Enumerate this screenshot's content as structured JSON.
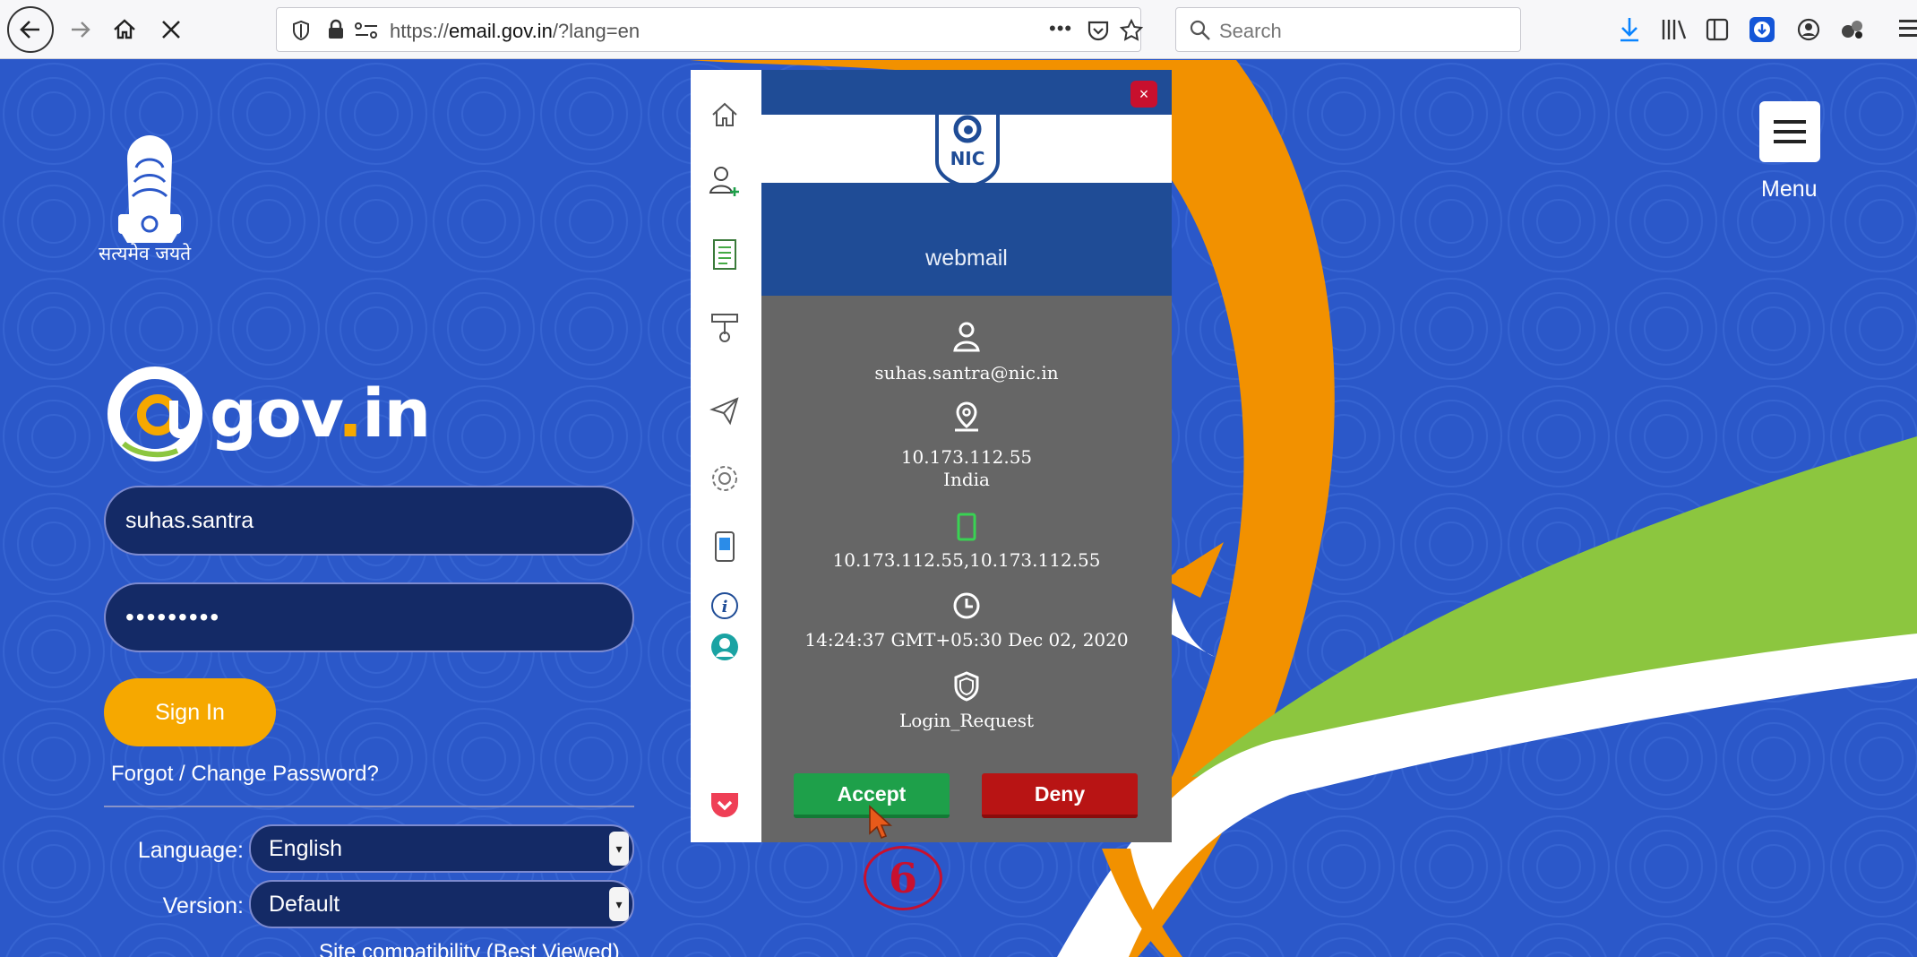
{
  "browser": {
    "url_prefix": "https://",
    "url_domain": "email.gov.in",
    "url_path": "/?lang=en",
    "search_placeholder": "Search"
  },
  "page": {
    "motto": "सत्यमेव जयते",
    "brand_name": "gov",
    "brand_dot": ".",
    "brand_tld": "in",
    "username": "suhas.santra",
    "password_mask": "•••••••••",
    "signin_label": "Sign In",
    "forgot_label": "Forgot / Change Password?",
    "language_label": "Language:",
    "language_value": "English",
    "version_label": "Version:",
    "version_value": "Default",
    "compat_label": "Site compatibility (Best Viewed)",
    "menu_label": "Menu"
  },
  "popup": {
    "logo_text": "NIC",
    "title": "webmail",
    "email": "suhas.santra@nic.in",
    "ip": "10.173.112.55",
    "country": "India",
    "device_ips": "10.173.112.55,10.173.112.55",
    "timestamp": "14:24:37 GMT+05:30 Dec 02, 2020",
    "request_type": "Login_Request",
    "accept_label": "Accept",
    "deny_label": "Deny",
    "close_symbol": "×"
  },
  "annotation": {
    "step_number": "6"
  },
  "colors": {
    "page_blue": "#2b58c9",
    "accent_orange": "#f6a800",
    "ribbon_green": "#8cc63f",
    "popup_navy": "#1f4c96",
    "popup_grey": "#666666",
    "accept_green": "#1ea04a",
    "deny_red": "#b81414",
    "pocket_red": "#ef3f56"
  }
}
